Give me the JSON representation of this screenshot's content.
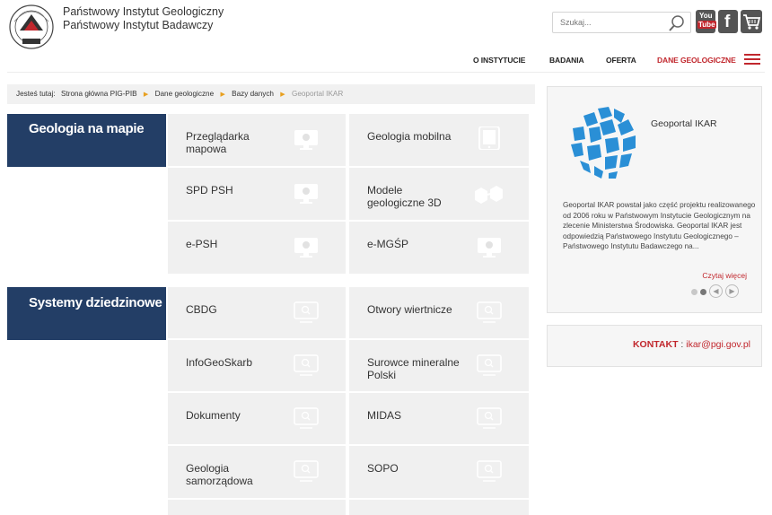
{
  "header": {
    "org_line1": "Państwowy Instytut Geologiczny",
    "org_line2": "Państwowy Instytut Badawczy",
    "search_placeholder": "Szukaj...",
    "youtube_label_top": "You",
    "youtube_label_bottom": "Tube",
    "facebook_label": "f"
  },
  "nav": {
    "items": [
      {
        "label": "O INSTYTUCIE"
      },
      {
        "label": "BADANIA"
      },
      {
        "label": "OFERTA"
      },
      {
        "label": "DANE GEOLOGICZNE",
        "active": true
      }
    ]
  },
  "breadcrumb": {
    "prefix": "Jesteś tutaj:",
    "items": [
      "Strona główna PIG-PIB",
      "Dane geologiczne",
      "Bazy danych"
    ],
    "current": "Geoportal IKAR"
  },
  "sections": [
    {
      "title": "Geologia na mapie",
      "tiles": [
        {
          "label": "Przeglądarka mapowa",
          "icon": "monitor-map-icon"
        },
        {
          "label": "Geologia mobilna",
          "icon": "tablet-icon"
        },
        {
          "label": "SPD PSH",
          "icon": "monitor-map-icon"
        },
        {
          "label": "Modele geologiczne 3D",
          "icon": "3d-model-icon"
        },
        {
          "label": "e-PSH",
          "icon": "monitor-map-icon"
        },
        {
          "label": "e-MGŚP",
          "icon": "monitor-map-icon"
        }
      ]
    },
    {
      "title": "Systemy dziedzinowe",
      "tiles": [
        {
          "label": "CBDG",
          "icon": "monitor-search-icon"
        },
        {
          "label": "Otwory wiertnicze",
          "icon": "monitor-search-icon"
        },
        {
          "label": "InfoGeoSkarb",
          "icon": "monitor-search-icon"
        },
        {
          "label": "Surowce mineralne Polski",
          "icon": "monitor-search-icon"
        },
        {
          "label": "Dokumenty",
          "icon": "monitor-search-icon"
        },
        {
          "label": "MIDAS",
          "icon": "monitor-search-icon"
        },
        {
          "label": "Geologia samorządowa",
          "icon": "monitor-search-icon"
        },
        {
          "label": "SOPO",
          "icon": "monitor-search-icon"
        }
      ]
    }
  ],
  "sidebar": {
    "card_title": "Geoportal IKAR",
    "card_text": "Geoportal IKAR powstał jako część projektu realizowanego od 2006 roku w Państwowym Instytucie Geologicznym na zlecenie Ministerstwa Środowiska. Geoportal IKAR jest odpowiedzią Państwowego Instytutu Geologicznego – Państwowego Instytutu Badawczego na...",
    "read_more": "Czytaj więcej",
    "contact_label": "KONTAKT",
    "contact_sep": ":",
    "contact_email": "ikar@pgi.gov.pl"
  },
  "colors": {
    "accent": "#c1272d",
    "section_bg": "#233e66",
    "tile_bg": "#f0f0f0",
    "globe_blue": "#2a8fd6"
  }
}
